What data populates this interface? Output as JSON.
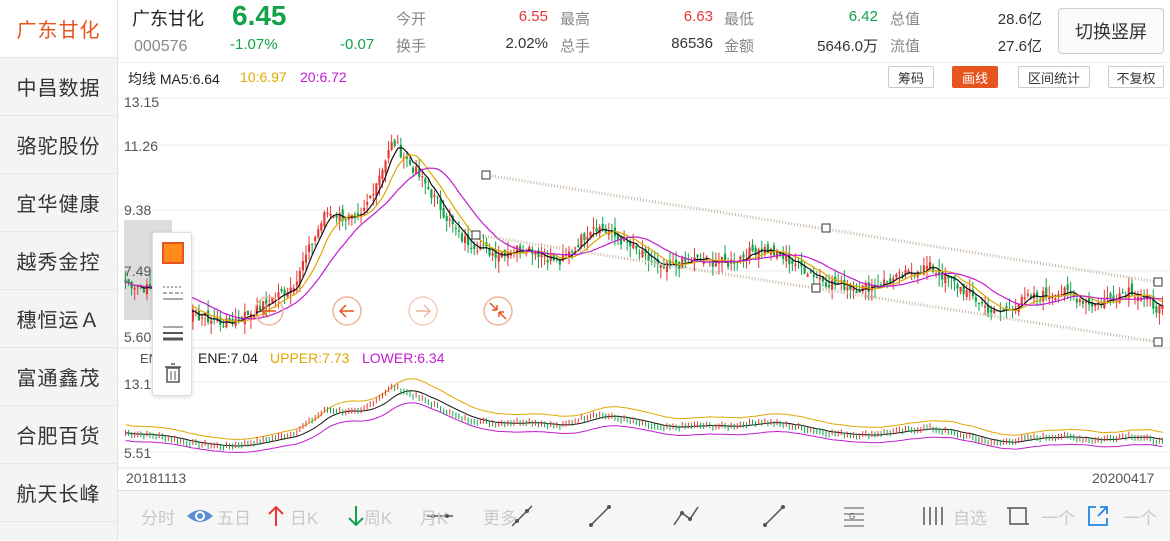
{
  "sidebar": {
    "items": [
      {
        "label": "广东甘化",
        "active": true
      },
      {
        "label": "中昌数据",
        "active": false
      },
      {
        "label": "骆驼股份",
        "active": false
      },
      {
        "label": "宜华健康",
        "active": false
      },
      {
        "label": "越秀金控",
        "active": false
      },
      {
        "label": "穗恒运Ａ",
        "active": false
      },
      {
        "label": "富通鑫茂",
        "active": false
      },
      {
        "label": "合肥百货",
        "active": false
      },
      {
        "label": "航天长峰",
        "active": false
      }
    ]
  },
  "quote": {
    "name": "广东甘化",
    "code": "000576",
    "price": "6.45",
    "change_pct": "-1.07%",
    "change": "-0.07",
    "fields": [
      {
        "label": "今开",
        "value": "6.55",
        "color": "#e53935"
      },
      {
        "label": "换手",
        "value": "2.02%",
        "color": "#333333"
      },
      {
        "label": "最高",
        "value": "6.63",
        "color": "#e53935"
      },
      {
        "label": "总手",
        "value": "86536",
        "color": "#333333"
      },
      {
        "label": "最低",
        "value": "6.42",
        "color": "#12a24a"
      },
      {
        "label": "金额",
        "value": "5646.0万",
        "color": "#333333"
      },
      {
        "label": "总值",
        "value": "28.6亿",
        "color": "#333333"
      },
      {
        "label": "流值",
        "value": "27.6亿",
        "color": "#333333"
      }
    ],
    "switch_button": "切换竖屏"
  },
  "ma_bar": {
    "prefix": "均线 MA5:6.64",
    "ma10": "10:6.97",
    "ma20": "20:6.72",
    "buttons": [
      {
        "label": "筹码",
        "active": false
      },
      {
        "label": "画线",
        "active": true
      },
      {
        "label": "区间统计",
        "active": false
      },
      {
        "label": "不复权",
        "active": false
      }
    ]
  },
  "chart": {
    "y_ticks": [
      "13.15",
      "11.26",
      "9.38",
      "7.49",
      "5.60"
    ],
    "ene_text": "ENE:7.04",
    "upper_text": "UPPER:7.73",
    "lower_text": "LOWER:6.34",
    "ene_panel_label": "ENE",
    "ene_y_top": "13.1",
    "ene_y_bottom": "5.51",
    "date_start": "20181113",
    "date_end": "20200417"
  },
  "chart_data": {
    "type": "candlestick",
    "y_ticks": [
      13.15,
      11.26,
      9.38,
      7.49,
      5.6
    ],
    "ylim": [
      5.6,
      13.15
    ],
    "x_range": [
      "20181113",
      "20200417"
    ],
    "indicators": {
      "MA5": 6.64,
      "MA10": 6.97,
      "MA20": 6.72,
      "ENE": 7.04,
      "UPPER": 7.73,
      "LOWER": 6.34
    },
    "close_trend": [
      7.4,
      7.1,
      6.4,
      6.1,
      6.6,
      7.3,
      9.6,
      9.3,
      11.8,
      10.4,
      8.8,
      8.3,
      8.5,
      8.0,
      9.2,
      8.6,
      7.8,
      8.1,
      8.0,
      8.5,
      8.0,
      7.4,
      7.2,
      7.5,
      7.9,
      7.2,
      6.4,
      6.9,
      7.1,
      6.7,
      7.2,
      6.5
    ],
    "colors": {
      "up": "#e53935",
      "down": "#12a24a",
      "ma5": "#111111",
      "ma10": "#e0a800",
      "ma20": "#c21bd1"
    }
  },
  "bottom_bar": {
    "labels": [
      "分时",
      "五日",
      "日K",
      "周K",
      "月K",
      "更多",
      "自选",
      "一个",
      "一个"
    ]
  },
  "colors": {
    "accent": "#e8541e",
    "up": "#e53935",
    "down": "#12a24a"
  }
}
